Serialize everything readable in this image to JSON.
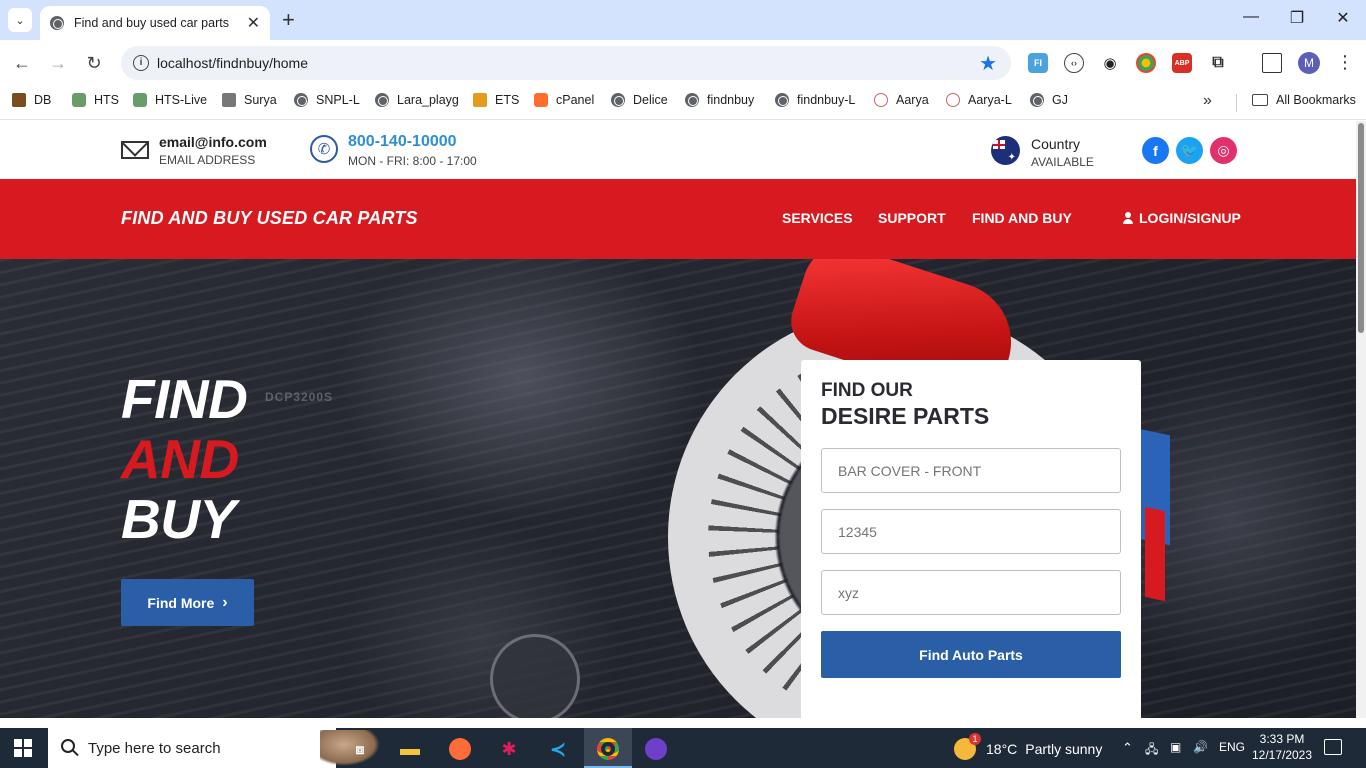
{
  "browser": {
    "tab_title": "Find and buy used car parts",
    "url": "localhost/findnbuy/home",
    "profile_initial": "M",
    "bookmarks": [
      "DB",
      "HTS",
      "HTS-Live",
      "Surya",
      "SNPL-L",
      "Lara_playg",
      "ETS",
      "cPanel",
      "Delice",
      "findnbuy",
      "findnbuy-L",
      "Aarya",
      "Aarya-L",
      "GJ"
    ],
    "all_bookmarks": "All Bookmarks"
  },
  "topbar": {
    "email": "email@info.com",
    "email_label": "EMAIL ADDRESS",
    "phone": "800-140-10000",
    "hours": "MON - FRI: 8:00 - 17:00",
    "country": "Country",
    "country_status": "AVAILABLE",
    "social": [
      "facebook-icon",
      "twitter-icon",
      "instagram-icon"
    ],
    "social_colors": [
      "#1877f2",
      "#1da1f2",
      "#e1306c"
    ]
  },
  "nav": {
    "brand": "FIND AND BUY USED CAR PARTS",
    "items": [
      "SERVICES",
      "SUPPORT",
      "FIND AND BUY"
    ],
    "login": "LOGIN/SIGNUP",
    "bar_color": "#d71920"
  },
  "hero": {
    "line1": "FIND",
    "line2": "AND",
    "line3": "BUY",
    "watermark": "DCP3200S",
    "cta": "Find More",
    "accent": "#2a5fa8"
  },
  "search_card": {
    "title1": "FIND OUR",
    "title2": "DESIRE PARTS",
    "fields": [
      {
        "placeholder": "BAR COVER - FRONT"
      },
      {
        "placeholder": "12345"
      },
      {
        "placeholder": "xyz"
      }
    ],
    "submit": "Find Auto Parts"
  },
  "taskbar": {
    "search_placeholder": "Type here to search",
    "weather_temp": "18°C",
    "weather_desc": "Partly sunny",
    "lang": "ENG",
    "time": "3:33 PM",
    "date": "12/17/2023"
  }
}
